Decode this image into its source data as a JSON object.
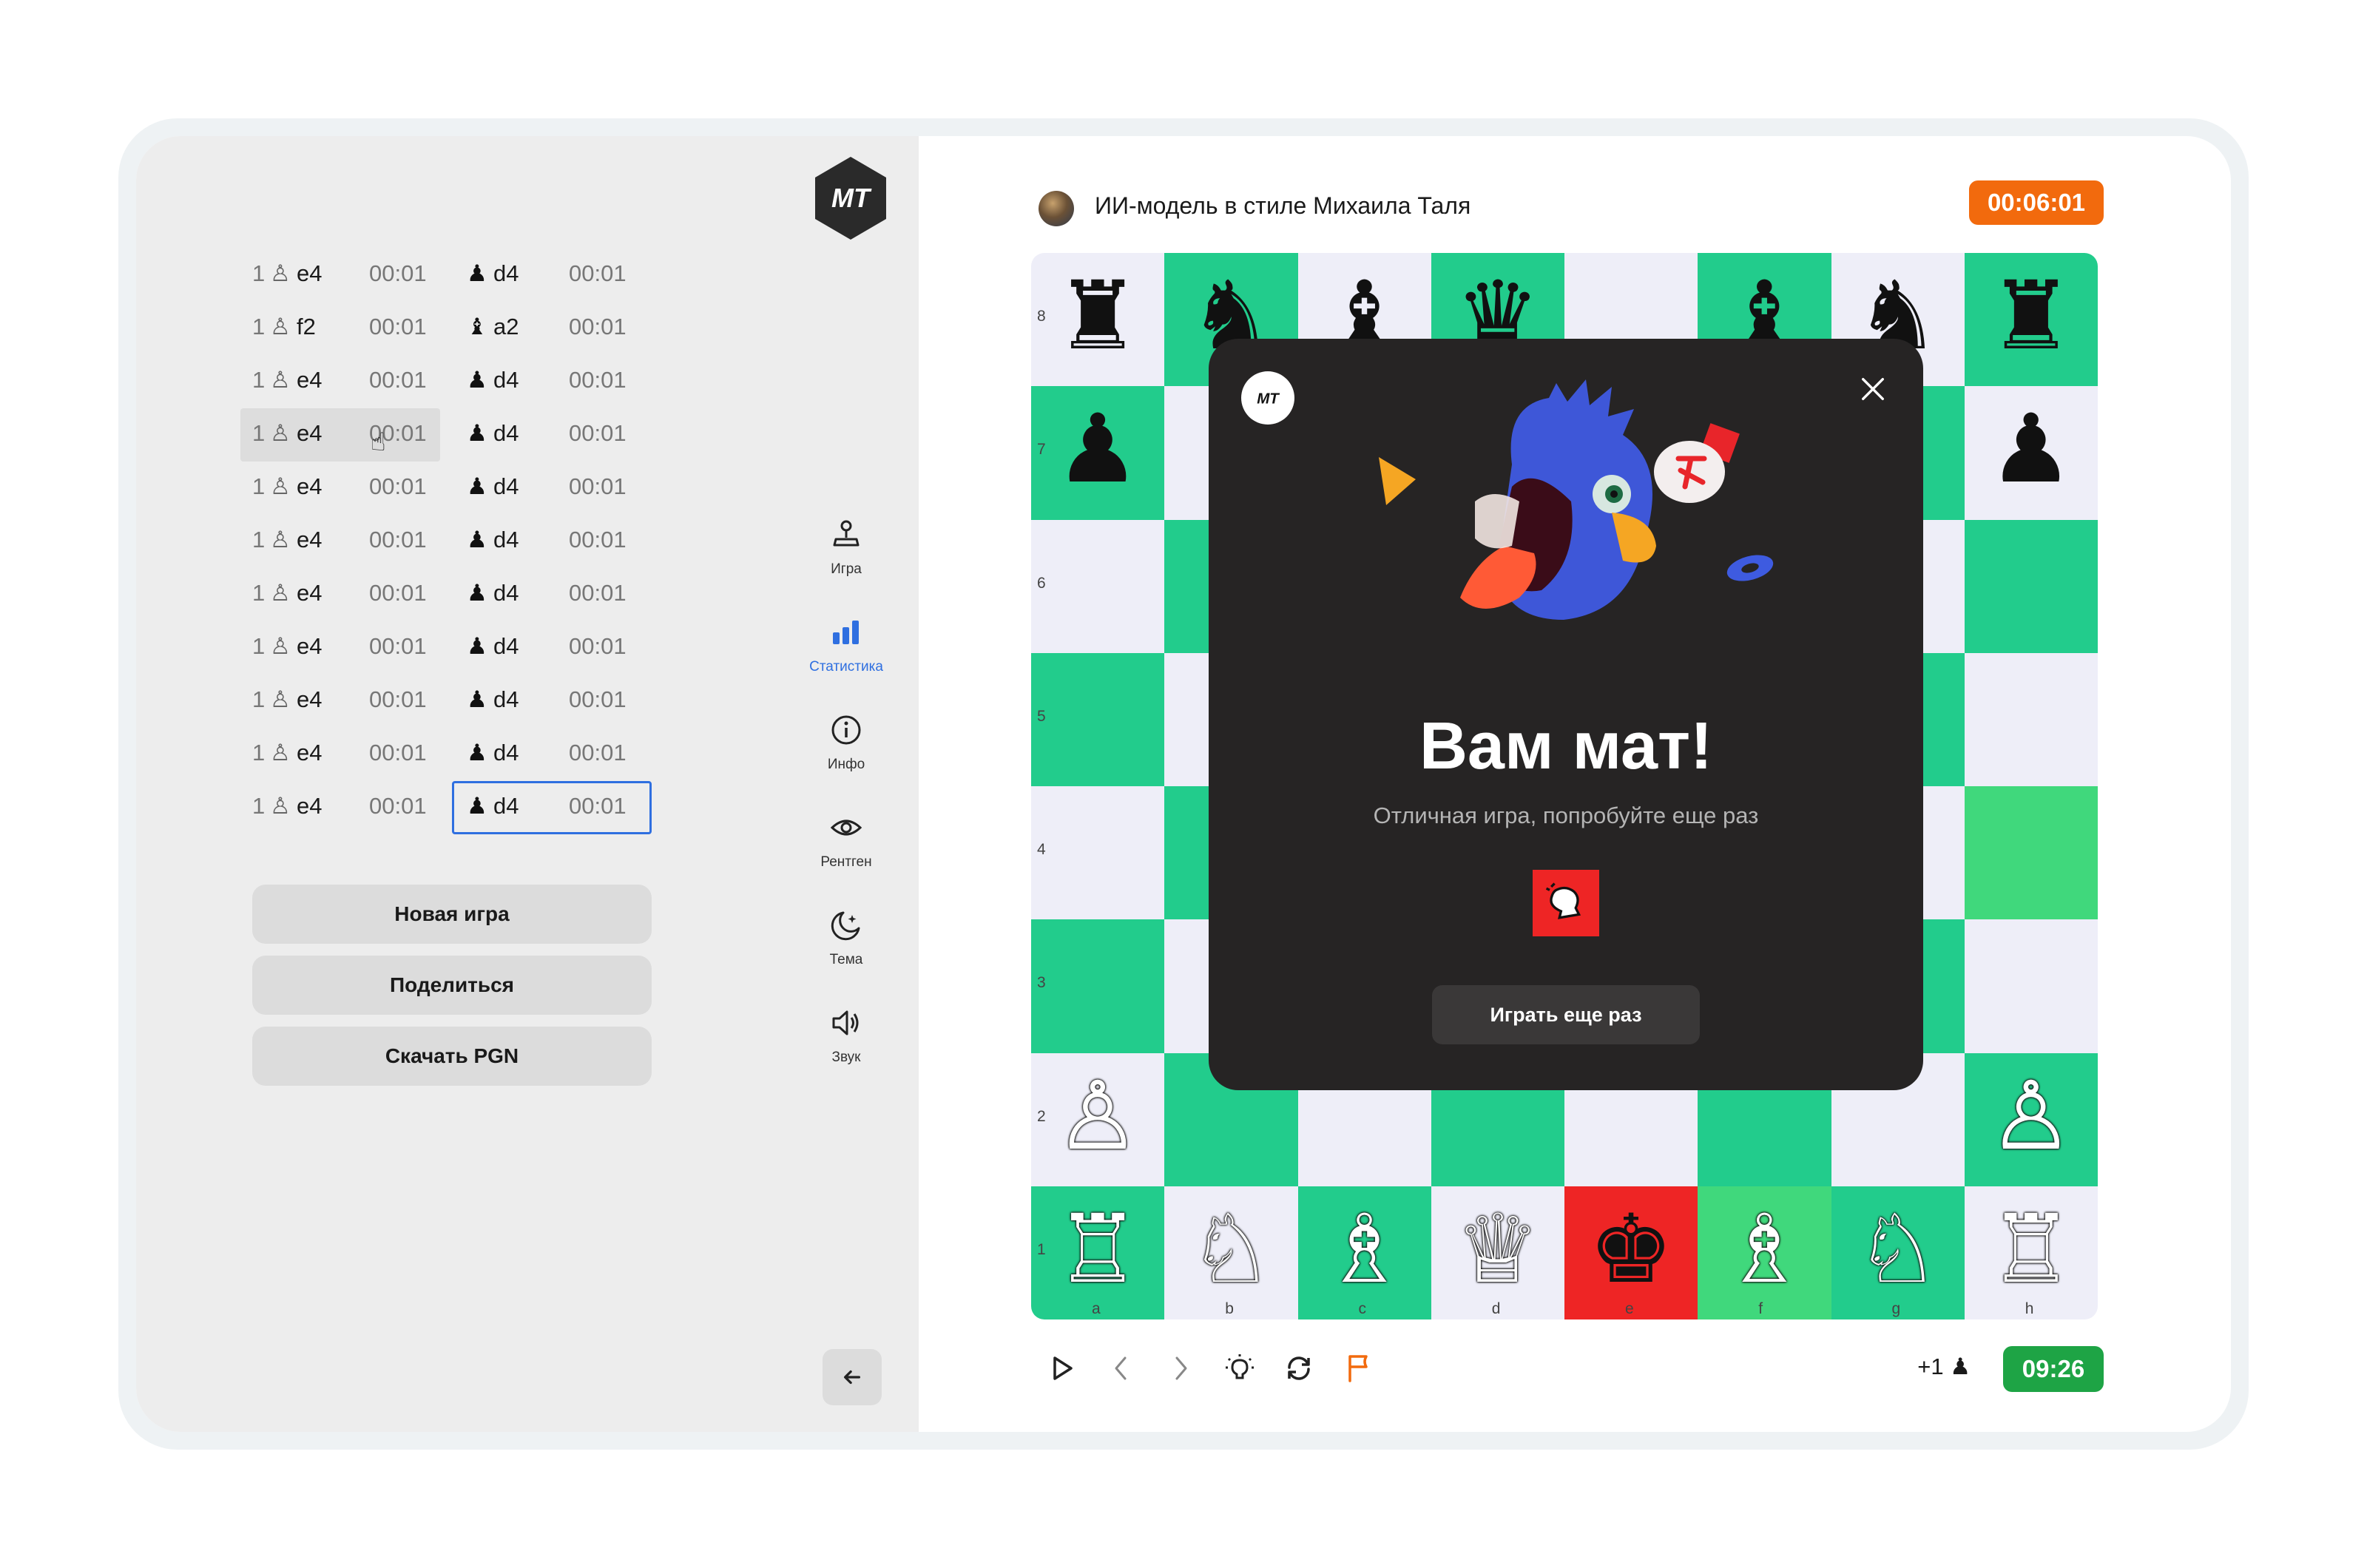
{
  "brand": {
    "logo_text": "MT"
  },
  "moves": [
    {
      "num": "1",
      "white_piece": "♙",
      "white_move": "e4",
      "white_time": "00:01",
      "black_piece": "♟",
      "black_move": "d4",
      "black_time": "00:01"
    },
    {
      "num": "1",
      "white_piece": "♙",
      "white_move": "f2",
      "white_time": "00:01",
      "black_piece": "♝",
      "black_move": "a2",
      "black_time": "00:01"
    },
    {
      "num": "1",
      "white_piece": "♙",
      "white_move": "e4",
      "white_time": "00:01",
      "black_piece": "♟",
      "black_move": "d4",
      "black_time": "00:01"
    },
    {
      "num": "1",
      "white_piece": "♙",
      "white_move": "e4",
      "white_time": "00:01",
      "black_piece": "♟",
      "black_move": "d4",
      "black_time": "00:01"
    },
    {
      "num": "1",
      "white_piece": "♙",
      "white_move": "e4",
      "white_time": "00:01",
      "black_piece": "♟",
      "black_move": "d4",
      "black_time": "00:01"
    },
    {
      "num": "1",
      "white_piece": "♙",
      "white_move": "e4",
      "white_time": "00:01",
      "black_piece": "♟",
      "black_move": "d4",
      "black_time": "00:01"
    },
    {
      "num": "1",
      "white_piece": "♙",
      "white_move": "e4",
      "white_time": "00:01",
      "black_piece": "♟",
      "black_move": "d4",
      "black_time": "00:01"
    },
    {
      "num": "1",
      "white_piece": "♙",
      "white_move": "e4",
      "white_time": "00:01",
      "black_piece": "♟",
      "black_move": "d4",
      "black_time": "00:01"
    },
    {
      "num": "1",
      "white_piece": "♙",
      "white_move": "e4",
      "white_time": "00:01",
      "black_piece": "♟",
      "black_move": "d4",
      "black_time": "00:01"
    },
    {
      "num": "1",
      "white_piece": "♙",
      "white_move": "e4",
      "white_time": "00:01",
      "black_piece": "♟",
      "black_move": "d4",
      "black_time": "00:01"
    },
    {
      "num": "1",
      "white_piece": "♙",
      "white_move": "e4",
      "white_time": "00:01",
      "black_piece": "♟",
      "black_move": "d4",
      "black_time": "00:01"
    }
  ],
  "moves_state": {
    "hovered_row": 3,
    "selected_row": 10
  },
  "actions": {
    "new_game": "Новая игра",
    "share": "Поделиться",
    "download_pgn": "Скачать PGN"
  },
  "nav": [
    {
      "id": "game",
      "label": "Игра",
      "icon": "joystick-icon",
      "active": false
    },
    {
      "id": "stats",
      "label": "Статистика",
      "icon": "bar-chart-icon",
      "active": true
    },
    {
      "id": "info",
      "label": "Инфо",
      "icon": "info-icon",
      "active": false
    },
    {
      "id": "xray",
      "label": "Рентген",
      "icon": "eye-icon",
      "active": false
    },
    {
      "id": "theme",
      "label": "Тема",
      "icon": "moon-icon",
      "active": false
    },
    {
      "id": "sound",
      "label": "Звук",
      "icon": "speaker-icon",
      "active": false
    }
  ],
  "opponent": {
    "name": "ИИ-модель в стиле Михаила Таля",
    "timer": "00:06:01"
  },
  "player": {
    "timer": "09:26",
    "material": "+1 ♟"
  },
  "board": {
    "ranks": [
      "8",
      "7",
      "6",
      "5",
      "4",
      "3",
      "2",
      "1"
    ],
    "files": [
      "a",
      "b",
      "c",
      "d",
      "e",
      "f",
      "g",
      "h"
    ],
    "highlighted_squares": [
      "h4",
      "f1"
    ],
    "checked_square": "e1",
    "pieces": [
      {
        "sq": "a8",
        "glyph": "♜",
        "color": "black"
      },
      {
        "sq": "b8",
        "glyph": "♞",
        "color": "black"
      },
      {
        "sq": "c8",
        "glyph": "♝",
        "color": "black"
      },
      {
        "sq": "d8",
        "glyph": "♛",
        "color": "black"
      },
      {
        "sq": "f8",
        "glyph": "♝",
        "color": "black"
      },
      {
        "sq": "g8",
        "glyph": "♞",
        "color": "black"
      },
      {
        "sq": "h8",
        "glyph": "♜",
        "color": "black"
      },
      {
        "sq": "a7",
        "glyph": "♟",
        "color": "black"
      },
      {
        "sq": "h7",
        "glyph": "♟",
        "color": "black"
      },
      {
        "sq": "a2",
        "glyph": "♙",
        "color": "white"
      },
      {
        "sq": "h2",
        "glyph": "♙",
        "color": "white"
      },
      {
        "sq": "a1",
        "glyph": "♖",
        "color": "white"
      },
      {
        "sq": "b1",
        "glyph": "♘",
        "color": "white"
      },
      {
        "sq": "c1",
        "glyph": "♗",
        "color": "white"
      },
      {
        "sq": "d1",
        "glyph": "♕",
        "color": "white"
      },
      {
        "sq": "e1",
        "glyph": "♚",
        "color": "black"
      },
      {
        "sq": "f1",
        "glyph": "♗",
        "color": "white"
      },
      {
        "sq": "g1",
        "glyph": "♘",
        "color": "white"
      },
      {
        "sq": "h1",
        "glyph": "♖",
        "color": "white"
      }
    ]
  },
  "modal": {
    "title": "Вам мат!",
    "subtitle": "Отличная игра, попробуйте еще раз",
    "button": "Играть еще раз"
  },
  "colors": {
    "board_dark": "#22cc8c",
    "board_light": "#eeeef8",
    "highlight": "#40d87c",
    "check": "#ee2525",
    "timer_opponent": "#f26a0d",
    "timer_player": "#1ea445",
    "accent": "#2f6fe0",
    "modal_bg": "#262424"
  }
}
